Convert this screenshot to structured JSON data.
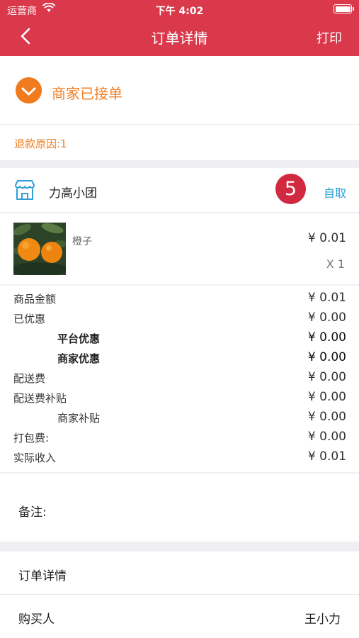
{
  "status_bar": {
    "carrier": "运营商",
    "time": "下午 4:02"
  },
  "nav": {
    "title": "订单详情",
    "print_label": "打印"
  },
  "order_status": {
    "text": "商家已接单",
    "refund_reason": "退款原因:1"
  },
  "shop": {
    "name": "力高小团",
    "badge": "5",
    "delivery_mode": "自取"
  },
  "product": {
    "name": "橙子",
    "price": "¥ 0.01",
    "quantity": "X 1"
  },
  "fees": [
    {
      "label": "商品金额",
      "value": "¥ 0.01"
    },
    {
      "label": "已优惠",
      "value": "¥ 0.00"
    },
    {
      "label": "平台优惠",
      "value": "¥ 0.00"
    },
    {
      "label": "商家优惠",
      "value": "¥ 0.00"
    },
    {
      "label": "配送费",
      "value": "¥ 0.00"
    },
    {
      "label": "配送费补贴",
      "value": "¥ 0.00"
    },
    {
      "label": "商家补贴",
      "value": "¥ 0.00"
    },
    {
      "label": "打包费:",
      "value": "¥ 0.00"
    },
    {
      "label": "实际收入",
      "value": "¥ 0.01"
    }
  ],
  "remark": {
    "label": "备注:"
  },
  "order_detail": {
    "title": "订单详情",
    "buyer_label": "购买人",
    "buyer_name": "王小力"
  },
  "colors": {
    "header": "#d9394b",
    "status_orange": "#ef7f24",
    "badge": "#d12a40",
    "pickup_blue": "#23a2d6"
  },
  "icons": [
    "back-arrow-icon",
    "wifi-icon",
    "battery-icon",
    "check-icon",
    "store-icon"
  ]
}
